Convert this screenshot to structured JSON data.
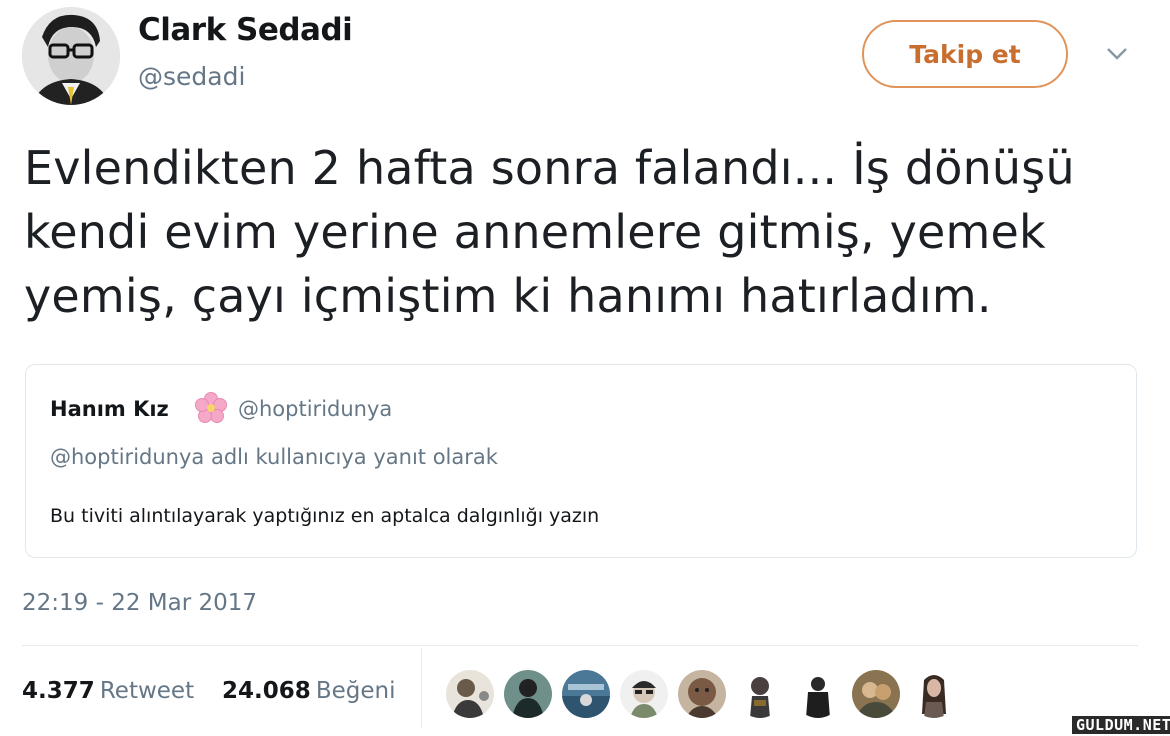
{
  "author": {
    "display_name": "Clark Sedadi",
    "handle": "@sedadi",
    "avatar_icon": "profile-photo-man-with-glasses"
  },
  "follow_button": {
    "label": "Takip et",
    "color": "#c86e2f"
  },
  "menu_icon": "chevron-down-icon",
  "tweet": {
    "lines": [
      "Evlendikten 2 hafta sonra falandı... İş dönüşü",
      "kendi evim yerine annemlere gitmiş, yemek",
      "yemiş, çayı içmiştim ki hanımı hatırladım."
    ]
  },
  "quoted": {
    "name": "Hanım Kız",
    "emoji_icon": "cherry-blossom-icon",
    "handle": "@hoptiridunya",
    "reply_context": "@hoptiridunya adlı kullanıcıya yanıt olarak",
    "text": "Bu tiviti alıntılayarak yaptığınız en aptalca dalgınlığı yazın"
  },
  "timestamp": "22:19 - 22 Mar 2017",
  "stats": {
    "retweet_count": "4.377",
    "retweet_label": "Retweet",
    "like_count": "24.068",
    "like_label": "Beğeni"
  },
  "likers": [
    {
      "icon": "liker-avatar-1",
      "color": "#d8d2c8"
    },
    {
      "icon": "liker-avatar-2",
      "color": "#3e5a5c"
    },
    {
      "icon": "liker-avatar-3",
      "color": "#4c7898"
    },
    {
      "icon": "liker-avatar-4",
      "color": "#c9c9c9"
    },
    {
      "icon": "liker-avatar-5",
      "color": "#7a5a44"
    },
    {
      "icon": "liker-avatar-6",
      "color": "#3a3a3a"
    },
    {
      "icon": "liker-avatar-7",
      "color": "#2b2b2b"
    },
    {
      "icon": "liker-avatar-8",
      "color": "#8a7350"
    },
    {
      "icon": "liker-avatar-9",
      "color": "#6b5a52"
    }
  ],
  "watermark": "GULDUM.NET"
}
